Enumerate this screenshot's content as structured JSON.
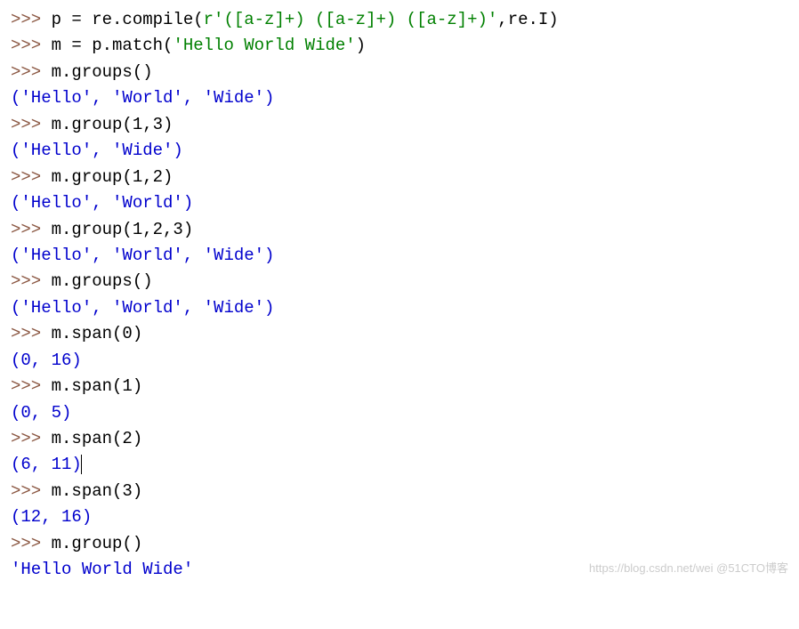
{
  "lines": {
    "l1": {
      "prompt": ">>> ",
      "c1": "p = re.compile(",
      "s1": "r'([a-z]+) ([a-z]+) ([a-z]+)'",
      "c2": ",re.I)"
    },
    "l2": {
      "prompt": ">>> ",
      "c1": "m = p.match(",
      "s1": "'Hello World Wide'",
      "c2": ")"
    },
    "l3": {
      "prompt": ">>> ",
      "c1": "m.groups()"
    },
    "l4": {
      "out": "('Hello', 'World', 'Wide')"
    },
    "l5": {
      "prompt": ">>> ",
      "c1": "m.group(1,3)"
    },
    "l6": {
      "out": "('Hello', 'Wide')"
    },
    "l7": {
      "prompt": ">>> ",
      "c1": "m.group(1,2)"
    },
    "l8": {
      "out": "('Hello', 'World')"
    },
    "l9": {
      "prompt": ">>> ",
      "c1": "m.group(1,2,3)"
    },
    "l10": {
      "out": "('Hello', 'World', 'Wide')"
    },
    "l11": {
      "prompt": ">>> ",
      "c1": "m.groups()"
    },
    "l12": {
      "out": "('Hello', 'World', 'Wide')"
    },
    "l13": {
      "prompt": ">>> ",
      "c1": "m.span(0)"
    },
    "l14": {
      "out": "(0, 16)"
    },
    "l15": {
      "prompt": ">>> ",
      "c1": "m.span(1)"
    },
    "l16": {
      "out": "(0, 5)"
    },
    "l17": {
      "prompt": ">>> ",
      "c1": "m.span(2)"
    },
    "l18": {
      "out": "(6, 11)"
    },
    "l19": {
      "prompt": ">>> ",
      "c1": "m.span(3)"
    },
    "l20": {
      "out": "(12, 16)"
    },
    "l21": {
      "prompt": ">>> ",
      "c1": "m.group()"
    },
    "l22": {
      "out": "'Hello World Wide'"
    }
  },
  "watermark": "https://blog.csdn.net/wei @51CTO博客"
}
